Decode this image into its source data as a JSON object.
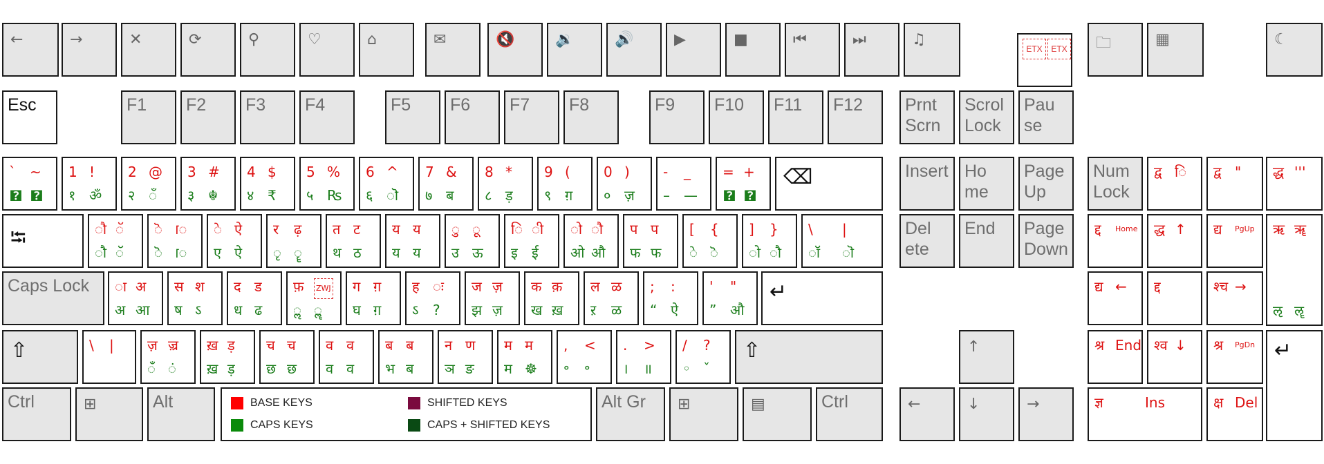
{
  "legend": {
    "base": {
      "label": "BASE KEYS",
      "color": "#ff0000"
    },
    "shifted": {
      "label": "SHIFTED KEYS",
      "color": "#7a0a3e"
    },
    "caps": {
      "label": "CAPS KEYS",
      "color": "#0a8a0a"
    },
    "caps_shifted": {
      "label": "CAPS + SHIFTED KEYS",
      "color": "#0a4a14"
    }
  },
  "keys": [
    {
      "id": "media-back",
      "icon": "arrow-left-icon",
      "glyph": "←"
    },
    {
      "id": "media-forward",
      "icon": "arrow-right-icon",
      "glyph": "→"
    },
    {
      "id": "media-stop",
      "icon": "close-icon",
      "glyph": "✕"
    },
    {
      "id": "media-refresh",
      "icon": "refresh-icon",
      "glyph": "⟳"
    },
    {
      "id": "media-search",
      "icon": "search-icon",
      "glyph": "⚲"
    },
    {
      "id": "media-favorites",
      "icon": "heart-icon",
      "glyph": "♡"
    },
    {
      "id": "media-home",
      "icon": "home-icon",
      "glyph": "⌂"
    },
    {
      "id": "media-mail",
      "icon": "mail-icon",
      "glyph": "✉"
    },
    {
      "id": "media-mute",
      "icon": "mute-icon",
      "glyph": "🔇"
    },
    {
      "id": "media-volume-down",
      "icon": "volume-down-icon",
      "glyph": "🔉"
    },
    {
      "id": "media-volume-up",
      "icon": "volume-up-icon",
      "glyph": "🔊"
    },
    {
      "id": "media-play",
      "icon": "play-icon",
      "glyph": "▶"
    },
    {
      "id": "media-stop2",
      "icon": "stop-icon",
      "glyph": "■"
    },
    {
      "id": "media-prev",
      "icon": "previous-track-icon",
      "glyph": "⏮"
    },
    {
      "id": "media-next",
      "icon": "next-track-icon",
      "glyph": "⏭"
    },
    {
      "id": "media-music",
      "icon": "music-icon",
      "glyph": "♫"
    },
    {
      "id": "etx",
      "etx": [
        "ETX",
        "ETX"
      ]
    },
    {
      "id": "my-computer",
      "icon": "folder-icon",
      "glyph": "🗀"
    },
    {
      "id": "calculator",
      "icon": "calculator-icon",
      "glyph": "▦"
    },
    {
      "id": "sleep",
      "icon": "moon-icon",
      "glyph": "☾"
    },
    {
      "id": "esc",
      "label": "Esc",
      "dark": true
    },
    {
      "id": "f1",
      "label": "F1"
    },
    {
      "id": "f2",
      "label": "F2"
    },
    {
      "id": "f3",
      "label": "F3"
    },
    {
      "id": "f4",
      "label": "F4"
    },
    {
      "id": "f5",
      "label": "F5"
    },
    {
      "id": "f6",
      "label": "F6"
    },
    {
      "id": "f7",
      "label": "F7"
    },
    {
      "id": "f8",
      "label": "F8"
    },
    {
      "id": "f9",
      "label": "F9"
    },
    {
      "id": "f10",
      "label": "F10"
    },
    {
      "id": "f11",
      "label": "F11"
    },
    {
      "id": "f12",
      "label": "F12"
    },
    {
      "id": "print-screen",
      "label": "Prnt\nScrn"
    },
    {
      "id": "scroll-lock",
      "label": "Scrol\nLock"
    },
    {
      "id": "pause",
      "label": "Pau\nse"
    },
    {
      "id": "backtick",
      "tl": "`",
      "tr": "~",
      "bl": "🯄",
      "br": "🯄"
    },
    {
      "id": "key-1",
      "tl": "1",
      "tr": "!",
      "bl": "१",
      "br": "ॐ"
    },
    {
      "id": "key-2",
      "tl": "2",
      "tr": "@",
      "bl": "२",
      "br": "ँ"
    },
    {
      "id": "key-3",
      "tl": "3",
      "tr": "#",
      "bl": "३",
      "br": "☬"
    },
    {
      "id": "key-4",
      "tl": "4",
      "tr": "$",
      "bl": "४",
      "br": "₹"
    },
    {
      "id": "key-5",
      "tl": "5",
      "tr": "%",
      "bl": "५",
      "br": "₨"
    },
    {
      "id": "key-6",
      "tl": "6",
      "tr": "^",
      "bl": "६",
      "br": "ॊ"
    },
    {
      "id": "key-7",
      "tl": "7",
      "tr": "&",
      "bl": "७",
      "br": "ब"
    },
    {
      "id": "key-8",
      "tl": "8",
      "tr": "*",
      "bl": "८",
      "br": "ड़"
    },
    {
      "id": "key-9",
      "tl": "9",
      "tr": "(",
      "bl": "९",
      "br": "ग़"
    },
    {
      "id": "key-0",
      "tl": "0",
      "tr": ")",
      "bl": "०",
      "br": "ज़"
    },
    {
      "id": "minus",
      "tl": "-",
      "tr": "_",
      "bl": "–",
      "br": "—"
    },
    {
      "id": "equals",
      "tl": "=",
      "tr": "+",
      "bl": "🯄",
      "br": "🯄"
    },
    {
      "id": "backspace",
      "icon": "backspace-icon",
      "glyph": "⌫"
    },
    {
      "id": "insert",
      "label": "Insert"
    },
    {
      "id": "home",
      "label": "Ho\nme"
    },
    {
      "id": "page-up",
      "label": "Page\nUp"
    },
    {
      "id": "num-lock",
      "label": "Num\nLock"
    },
    {
      "id": "num-divide",
      "tl": "द्व",
      "tr": "◌ि"
    },
    {
      "id": "num-multiply",
      "tl": "द्व",
      "tr": "\""
    },
    {
      "id": "num-minus",
      "tl": "द्ध",
      "tr": "'''"
    },
    {
      "id": "tab",
      "icon": "tab-icon",
      "glyph": "⭾"
    },
    {
      "id": "key-q",
      "tl": "◌ौ",
      "tr": "◌ॅ",
      "bl": "◌ौ",
      "br": "◌ॅ"
    },
    {
      "id": "key-w",
      "tl": "◌ॆ",
      "tr": "ॎ",
      "bl": "◌ॆ",
      "br": "ॎ"
    },
    {
      "id": "key-e",
      "tl": "◌े",
      "tr": "ऐ",
      "bl": "ए",
      "br": "ऐ"
    },
    {
      "id": "key-r",
      "tl": "र",
      "tr": "ढ़",
      "bl": "◌ृ",
      "br": "◌ॄ"
    },
    {
      "id": "key-t",
      "tl": "त",
      "tr": "ट",
      "bl": "थ",
      "br": "ठ"
    },
    {
      "id": "key-y",
      "tl": "य",
      "tr": "य",
      "bl": "य",
      "br": "य"
    },
    {
      "id": "key-u",
      "tl": "◌ु",
      "tr": "◌ू",
      "bl": "उ",
      "br": "ऊ"
    },
    {
      "id": "key-i",
      "tl": "◌ि",
      "tr": "◌ी",
      "bl": "इ",
      "br": "ई"
    },
    {
      "id": "key-o",
      "tl": "◌ो",
      "tr": "◌ौ",
      "bl": "ओ",
      "br": "औ"
    },
    {
      "id": "key-p",
      "tl": "प",
      "tr": "प",
      "bl": "फ",
      "br": "फ"
    },
    {
      "id": "bracket-left",
      "tl": "[",
      "tr": "{",
      "bl": "◌े",
      "br": "ॆ"
    },
    {
      "id": "bracket-right",
      "tl": "]",
      "tr": "}",
      "bl": "◌ो",
      "br": "◌ौ"
    },
    {
      "id": "backslash",
      "tl": "\\",
      "tr": "|",
      "bl": "◌ॉ",
      "br": "◌ॊ"
    },
    {
      "id": "delete",
      "label": "Del\nete"
    },
    {
      "id": "end",
      "label": "End"
    },
    {
      "id": "page-down",
      "label": "Page\nDown"
    },
    {
      "id": "num-7",
      "tl": "द्द",
      "tr": "Home"
    },
    {
      "id": "num-8",
      "tl": "द्ध",
      "tr": "↑"
    },
    {
      "id": "num-9",
      "tl": "द्य",
      "tr": "PgUp"
    },
    {
      "id": "num-plus",
      "tl": "ऋ",
      "tr": "ॠ",
      "bl": "ऌ",
      "br": "ॡ"
    },
    {
      "id": "caps-lock",
      "label": "Caps Lock"
    },
    {
      "id": "key-a",
      "tl": "◌ा",
      "tr": "अ",
      "bl": "अ",
      "br": "आ"
    },
    {
      "id": "key-s",
      "tl": "स",
      "tr": "श",
      "bl": "ष",
      "br": "ऽ"
    },
    {
      "id": "key-d",
      "tl": "द",
      "tr": "ड",
      "bl": "ध",
      "br": "ढ"
    },
    {
      "id": "key-f",
      "tl": "फ़",
      "tr": "ZWJ",
      "bl": "◌ॢ",
      "br": "◌ॣ"
    },
    {
      "id": "key-g",
      "tl": "ग",
      "tr": "ग़",
      "bl": "घ",
      "br": "ग़"
    },
    {
      "id": "key-h",
      "tl": "ह",
      "tr": "◌ः",
      "bl": "ऽ",
      "br": "?"
    },
    {
      "id": "key-j",
      "tl": "ज",
      "tr": "ज़",
      "bl": "झ",
      "br": "ज़"
    },
    {
      "id": "key-k",
      "tl": "क",
      "tr": "क़",
      "bl": "ख",
      "br": "ख़"
    },
    {
      "id": "key-l",
      "tl": "ल",
      "tr": "ळ",
      "bl": "ऱ",
      "br": "ळ"
    },
    {
      "id": "semicolon",
      "tl": ";",
      "tr": ":",
      "bl": "“",
      "br": "ऐ"
    },
    {
      "id": "quote",
      "tl": "'",
      "tr": "\"",
      "bl": "”",
      "br": "औ"
    },
    {
      "id": "enter",
      "icon": "enter-icon",
      "glyph": "↵"
    },
    {
      "id": "num-4",
      "tl": "द्य",
      "tr": "←"
    },
    {
      "id": "num-5",
      "tl": "द्द"
    },
    {
      "id": "num-6",
      "tl": "श्च",
      "tr": "→"
    },
    {
      "id": "left-shift",
      "icon": "shift-icon",
      "glyph": "⇧"
    },
    {
      "id": "intl-backslash",
      "tl": "\\",
      "tr": "|"
    },
    {
      "id": "key-z",
      "tl": "ज़",
      "tr": "ज़्र",
      "bl": "◌ँ",
      "br": "◌ं"
    },
    {
      "id": "key-x",
      "tl": "ख़",
      "tr": "ड़",
      "bl": "ख़",
      "br": "ड़"
    },
    {
      "id": "key-c",
      "tl": "च",
      "tr": "च",
      "bl": "छ",
      "br": "छ"
    },
    {
      "id": "key-v",
      "tl": "व",
      "tr": "व",
      "bl": "व",
      "br": "व"
    },
    {
      "id": "key-b",
      "tl": "ब",
      "tr": "ब",
      "bl": "भ",
      "br": "ब"
    },
    {
      "id": "key-n",
      "tl": "न",
      "tr": "ण",
      "bl": "ञ",
      "br": "ङ"
    },
    {
      "id": "key-m",
      "tl": "म",
      "tr": "म",
      "bl": "म",
      "br": "☸"
    },
    {
      "id": "comma",
      "tl": ",",
      "tr": "<",
      "bl": "॰",
      "br": "॰"
    },
    {
      "id": "period",
      "tl": ".",
      "tr": ">",
      "bl": "।",
      "br": "॥"
    },
    {
      "id": "slash",
      "tl": "/",
      "tr": "?",
      "bl": "◦",
      "br": "ˇ"
    },
    {
      "id": "right-shift",
      "icon": "shift-icon",
      "glyph": "⇧"
    },
    {
      "id": "arrow-up",
      "icon": "arrow-up-icon",
      "glyph": "↑"
    },
    {
      "id": "num-1",
      "tl": "श्र",
      "tr": "End"
    },
    {
      "id": "num-2",
      "tl": "श्व",
      "tr": "↓"
    },
    {
      "id": "num-3",
      "tl": "श्र",
      "tr": "PgDn"
    },
    {
      "id": "num-enter",
      "icon": "enter-icon",
      "glyph": "↵"
    },
    {
      "id": "left-ctrl",
      "label": "Ctrl"
    },
    {
      "id": "left-win",
      "icon": "windows-icon",
      "glyph": "⊞"
    },
    {
      "id": "left-alt",
      "label": "Alt"
    },
    {
      "id": "alt-gr",
      "label": "Alt Gr"
    },
    {
      "id": "right-win",
      "icon": "windows-icon",
      "glyph": "⊞"
    },
    {
      "id": "menu",
      "icon": "menu-icon",
      "glyph": "▤"
    },
    {
      "id": "right-ctrl",
      "label": "Ctrl"
    },
    {
      "id": "arrow-left",
      "icon": "arrow-left-icon",
      "glyph": "←"
    },
    {
      "id": "arrow-down",
      "icon": "arrow-down-icon",
      "glyph": "↓"
    },
    {
      "id": "arrow-right",
      "icon": "arrow-right-icon",
      "glyph": "→"
    },
    {
      "id": "num-0",
      "tl": "ज्ञ",
      "tr": "Ins"
    },
    {
      "id": "num-decimal",
      "tl": "क्ष",
      "tr": "Del"
    }
  ]
}
